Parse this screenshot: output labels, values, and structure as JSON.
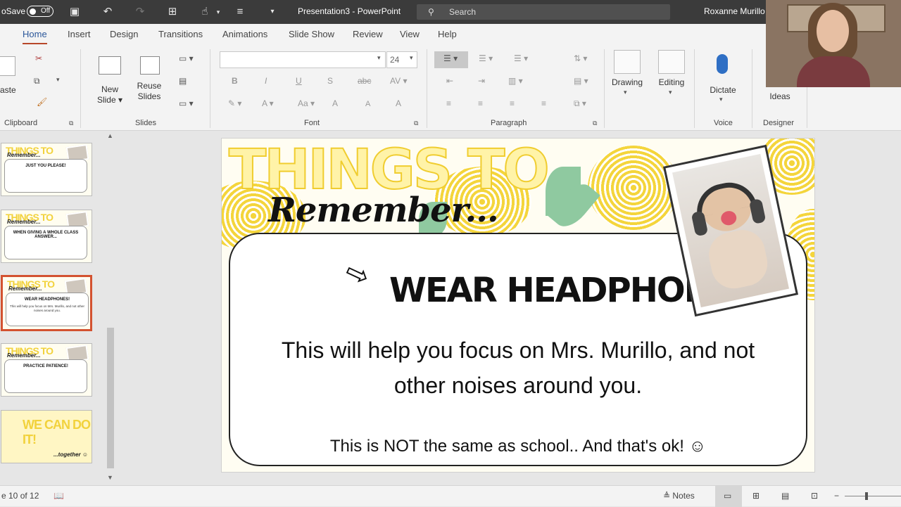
{
  "titlebar": {
    "autosave_label": "oSave",
    "autosave_state": "Off",
    "doc_title": "Presentation3 - PowerPoint",
    "search_placeholder": "Search",
    "user_name": "Roxanne Murillo"
  },
  "tabs": [
    "Home",
    "Insert",
    "Design",
    "Transitions",
    "Animations",
    "Slide Show",
    "Review",
    "View",
    "Help"
  ],
  "active_tab": "Home",
  "ribbon": {
    "clipboard": {
      "paste_label": "aste",
      "group_label": "Clipboard"
    },
    "slides": {
      "new_slide_label": "New",
      "new_slide_label2": "Slide",
      "reuse_label": "Reuse",
      "reuse_label2": "Slides",
      "group_label": "Slides"
    },
    "font": {
      "font_name": "",
      "font_size": "24",
      "group_label": "Font"
    },
    "paragraph": {
      "group_label": "Paragraph"
    },
    "drawing": {
      "label": "Drawing"
    },
    "editing": {
      "label": "Editing"
    },
    "voice": {
      "dictate_label": "Dictate",
      "group_label": "Voice"
    },
    "designer": {
      "ideas_label": "Ideas",
      "group_label": "Designer"
    }
  },
  "thumbnails": [
    {
      "heading": "JUST YOU PLEASE!",
      "title": "THINGS TO",
      "remember": "Remember..."
    },
    {
      "heading": "WHEN GIVING A WHOLE CLASS ANSWER...",
      "title": "THINGS TO",
      "remember": "Remember..."
    },
    {
      "heading": "WEAR HEADPHONES!",
      "title": "THINGS TO",
      "remember": "Remember...",
      "body": "This will help you focus on Mrs. Murillo, and not other noises around you."
    },
    {
      "heading": "PRACTICE PATIENCE!",
      "title": "THINGS TO",
      "remember": "Remember..."
    },
    {
      "heading": "WE CAN DO IT!",
      "footer": "...together ☺"
    }
  ],
  "slide": {
    "title_line1": "THINGS TO",
    "title_line2": "Remember...",
    "heading": "WEAR HEADPHONES!",
    "body_line1": "This will help you focus on Mrs. Murillo, and not",
    "body_line2": "other noises around you.",
    "footer": "This is NOT the same as school.. And that's ok! ☺"
  },
  "status": {
    "slide_counter": "e 10 of 12",
    "notes_label": "Notes"
  },
  "colors": {
    "accent": "#b7472a",
    "selection": "#d35230",
    "pineapple": "#f4d53c",
    "leaf": "#8fc9a0"
  }
}
